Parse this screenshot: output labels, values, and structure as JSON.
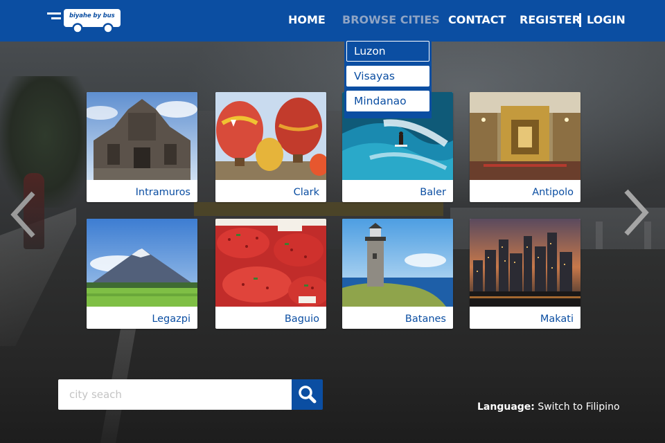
{
  "brand": {
    "logo_text": "biyahe by bus",
    "color": "#0b4ea2"
  },
  "nav": {
    "home": "HOME",
    "browse": "BROWSE CITIES",
    "contact": "CONTACT",
    "register": "REGISTER",
    "login": "LOGIN",
    "active": "BROWSE CITIES"
  },
  "dropdown": {
    "items": [
      "Luzon",
      "Visayas",
      "Mindanao"
    ],
    "selected": "Luzon"
  },
  "cities": [
    {
      "name": "Intramuros",
      "icon": "fort-santiago-photo"
    },
    {
      "name": "Clark",
      "icon": "hot-air-balloons-photo"
    },
    {
      "name": "Baler",
      "icon": "surfing-wave-photo"
    },
    {
      "name": "Antipolo",
      "icon": "church-altar-photo"
    },
    {
      "name": "Legazpi",
      "icon": "mayon-volcano-photo"
    },
    {
      "name": "Baguio",
      "icon": "strawberries-photo"
    },
    {
      "name": "Batanes",
      "icon": "lighthouse-photo"
    },
    {
      "name": "Makati",
      "icon": "city-skyline-photo"
    }
  ],
  "search": {
    "placeholder": "city seach",
    "value": ""
  },
  "language": {
    "label": "Language:",
    "link": "Switch to Filipino"
  },
  "icons": {
    "prev": "chevron-left-icon",
    "next": "chevron-right-icon",
    "search": "search-icon"
  }
}
